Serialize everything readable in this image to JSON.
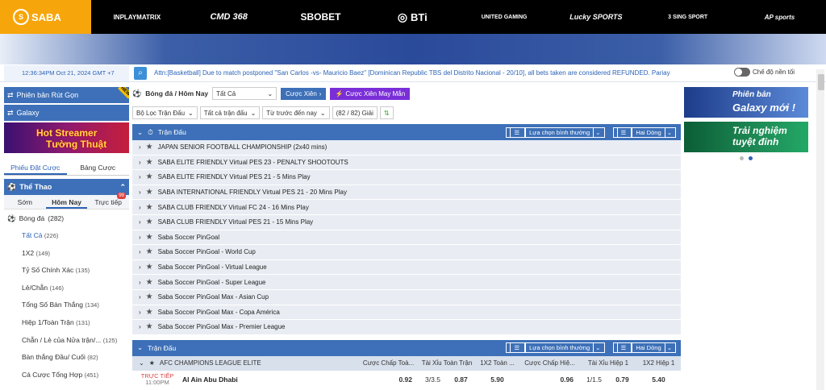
{
  "top": {
    "logo": "SABA",
    "partners": [
      "INPLAYMATRIX",
      "CMD 368",
      "SBOBET",
      "BTi",
      "UNITED GAMING",
      "Lucky SPORTS",
      "3 SING SPORT",
      "AP sports"
    ]
  },
  "info": {
    "time": "12:36:34PM Oct 21, 2024 GMT +7",
    "ticker": "Attn:[Basketball] Due to match postponed \"San Carlos -vs- Mauricio Baez\" [Dominican Republic TBS del Distrito Nacional - 20/10], all bets taken are considered REFUNDED. Pariay",
    "night_mode": "Chế độ nền tối"
  },
  "left": {
    "btn1": "Phiên bản Rút Gọn",
    "btn2": "Galaxy",
    "streamer1": "Hot Streamer",
    "streamer2": "Tường Thuật",
    "tab_bet": "Phiếu Đặt Cược",
    "tab_board": "Bảng Cược",
    "sports": "Thể Thao",
    "sub_early": "Sớm",
    "sub_today": "Hôm Nay",
    "sub_live": "Trực tiếp",
    "live_badge": "99",
    "football": "Bóng đá",
    "football_count": "(282)",
    "menu": [
      {
        "label": "Tất Cả",
        "count": "(226)"
      },
      {
        "label": "1X2",
        "count": "(149)"
      },
      {
        "label": "Tỷ Số Chính Xác",
        "count": "(135)"
      },
      {
        "label": "Lẻ/Chẵn",
        "count": "(146)"
      },
      {
        "label": "Tổng Số Bàn Thắng",
        "count": "(134)"
      },
      {
        "label": "Hiệp 1/Toàn Trận",
        "count": "(131)"
      },
      {
        "label": "Chẵn / Lẻ của Nửa trận/...",
        "count": "(125)"
      },
      {
        "label": "Bàn thắng Đầu/ Cuối",
        "count": "(82)"
      },
      {
        "label": "Cá Cược Tổng Hợp",
        "count": "(451)"
      }
    ]
  },
  "center": {
    "crumb": "Bóng đá / Hôm Nay",
    "select_all": "Tất Cả",
    "cuoc_xien": "Cược Xiên",
    "cuoc_xien_may_man": "Cược Xiên May Mắn",
    "filter_league": "Bộ Lọc Trận Đấu",
    "filter_all": "Tất cả trận đấu",
    "filter_time": "Từ trước đến nay",
    "game_count": "(82 / 82) Giải",
    "section": "Trận Đấu",
    "sel_normal": "Lựa chọn bình thường",
    "two_lines": "Hai Dòng",
    "leagues": [
      "JAPAN SENIOR FOOTBALL CHAMPIONSHIP (2x40 mins)",
      "SABA ELITE FRIENDLY Virtual PES 23 - PENALTY SHOOTOUTS",
      "SABA ELITE FRIENDLY Virtual PES 21 - 5 Mins Play",
      "SABA INTERNATIONAL FRIENDLY Virtual PES 21 - 20 Mins Play",
      "SABA CLUB FRIENDLY Virtual FC 24 - 16 Mins Play",
      "SABA CLUB FRIENDLY Virtual PES 21 - 15 Mins Play",
      "Saba Soccer PinGoal",
      "Saba Soccer PinGoal - World Cup",
      "Saba Soccer PinGoal - Virtual League",
      "Saba Soccer PinGoal - Super League",
      "Saba Soccer PinGoal Max - Asian Cup",
      "Saba Soccer PinGoal Max - Copa América",
      "Saba Soccer PinGoal Max - Premier League"
    ],
    "section2": "Trận Đấu",
    "league_afc": "AFC CHAMPIONS LEAGUE ELITE",
    "cols": [
      "Cược Chấp Toà...",
      "Tài Xỉu Toàn Trận",
      "1X2 Toàn ...",
      "Cược Chấp Hiệ...",
      "Tài Xỉu Hiệp 1",
      "1X2 Hiệp 1"
    ],
    "match": {
      "status": "TRỰC TIẾP",
      "time": "11:00PM",
      "team": "Al Ain Abu Dhabi",
      "odds": [
        "0.92",
        "3/3.5",
        "0.87",
        "5.90",
        "0.96",
        "1/1.5",
        "0.79",
        "5.40"
      ]
    }
  },
  "right": {
    "ad1a": "Phiên bản",
    "ad1b": "Galaxy mới !",
    "ad2a": "Trải nghiệm",
    "ad2b": "tuyệt đỉnh"
  }
}
